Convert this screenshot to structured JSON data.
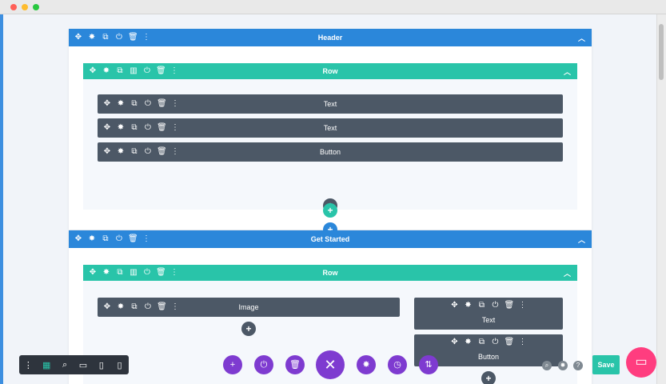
{
  "icons": {
    "move": "✥",
    "settings": "✸",
    "duplicate": "⧉",
    "columns": "▥",
    "power": "⏻",
    "trash": "🗑",
    "more": "⋮",
    "chevron_up": "︿",
    "plus": "+",
    "close": "✕",
    "history": "◷",
    "portability": "⇅",
    "search": "⌕",
    "desktop": "▭",
    "tablet": "▯",
    "phone": "▯",
    "wireframe": "▦",
    "help": "?",
    "chat": "▭"
  },
  "sections": [
    {
      "title": "Header",
      "row": {
        "title": "Row",
        "modules": [
          "Text",
          "Text",
          "Button"
        ]
      }
    },
    {
      "title": "Get Started",
      "row": {
        "title": "Row",
        "left_module": "Image",
        "right_modules": [
          "Text",
          "Button"
        ]
      }
    }
  ],
  "footer": {
    "save_label": "Save"
  },
  "colors": {
    "section_blue": "#2b87da",
    "row_teal": "#29c4a9",
    "module_dark": "#4c5866",
    "builder_purple": "#7e3bd0",
    "chat_pink": "#ff3d7f"
  }
}
